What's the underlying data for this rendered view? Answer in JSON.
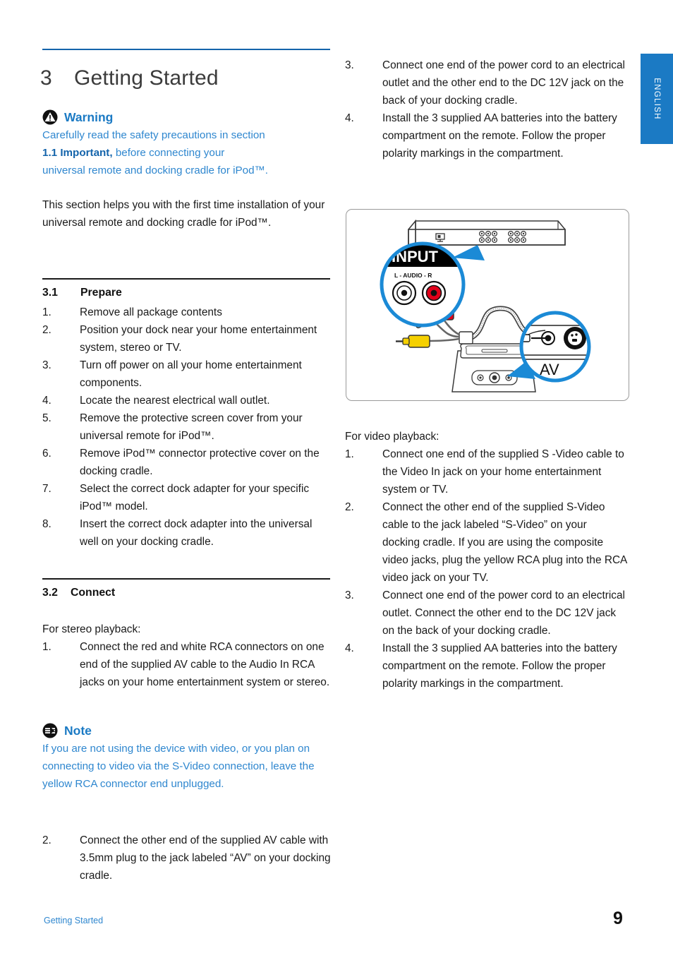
{
  "language_tab": {
    "label": "ENGLISH"
  },
  "chapter": {
    "number": "3",
    "title": "Getting Started"
  },
  "warning": {
    "icon": "warning-triangle-icon",
    "title": "Warning",
    "line1": "Carefully read the safety precautions in section",
    "emphasis": "1.1 Important,",
    "line2_rest": " before connecting your",
    "line3": "universal remote and docking cradle for iPod™."
  },
  "intro_paragraph": "This section helps you with the first time installation of your universal remote and docking cradle for iPod™.",
  "section_prepare": {
    "number": "3.1",
    "title": "Prepare",
    "steps": [
      {
        "n": "1.",
        "text": "Remove all package contents"
      },
      {
        "n": "2.",
        "text": "Position your dock near your home entertainment system, stereo or TV."
      },
      {
        "n": "3.",
        "text": "Turn off power on all your home entertainment components."
      },
      {
        "n": "4.",
        "text": "Locate the nearest electrical wall outlet."
      },
      {
        "n": "5.",
        "text": "Remove the protective screen cover from your universal remote for iPod™."
      },
      {
        "n": "6.",
        "text": "Remove iPod™ connector protective cover on the docking cradle."
      },
      {
        "n": "7.",
        "text": "Select the correct dock adapter for your specific iPod™ model."
      },
      {
        "n": "8.",
        "text": "Insert the correct dock adapter into the universal well on your docking cradle."
      }
    ]
  },
  "section_connect": {
    "number": "3.2",
    "title": "Connect",
    "stereo_heading": "For stereo playback:",
    "stereo_steps_before_note": [
      {
        "n": "1.",
        "text": "Connect the red and white RCA connectors on one end of the supplied AV cable to the Audio In RCA  jacks on your home entertainment system or stereo."
      }
    ],
    "stereo_steps_after_note": [
      {
        "n": "2.",
        "text": "Connect the other end of the supplied AV cable with 3.5mm plug to the jack labeled “AV” on your docking cradle."
      }
    ]
  },
  "note": {
    "icon": "note-lines-icon",
    "title": "Note",
    "body": "If you are not using the device with video, or you plan on connecting to video via the S-Video connection, leave the yellow RCA connector end unplugged."
  },
  "right_column": {
    "top_steps": [
      {
        "n": "3.",
        "text": "Connect one end of the power cord to an electrical outlet and the other end to the DC 12V jack on the back of your docking cradle."
      },
      {
        "n": "4.",
        "text": "Install the 3 supplied AA batteries into the battery compartment on the remote. Follow the proper polarity markings in the compartment."
      }
    ],
    "video_heading": "For video playback:",
    "video_steps": [
      {
        "n": "1.",
        "text": "Connect one end of the supplied S -Video cable to the Video In jack on your home entertainment system or TV."
      },
      {
        "n": "2.",
        "text": "Connect the other end of the supplied S-Video cable to the jack labeled “S-Video” on your docking cradle. If you are using the composite video jacks, plug the yellow RCA plug into the RCA video jack on your TV."
      },
      {
        "n": "3.",
        "text": "Connect one end of the power cord to an electrical outlet. Connect the other end to the DC 12V jack on the back of your docking cradle."
      },
      {
        "n": "4.",
        "text": "Install the 3 supplied AA batteries into the battery compartment on the remote. Follow the proper polarity markings in the compartment."
      }
    ]
  },
  "figure": {
    "name": "connection-diagram",
    "callout_input_label": "INPUT",
    "callout_audio_label": "L - AUDIO - R",
    "callout_av_label": "AV",
    "colors": {
      "callout_blue": "#1b8ad6",
      "rca_red": "#e2001a",
      "rca_yellow": "#f5d000",
      "rca_white": "#ffffff",
      "panel_black": "#000000"
    }
  },
  "footer": {
    "left_label": "Getting Started",
    "page_number": "9"
  }
}
